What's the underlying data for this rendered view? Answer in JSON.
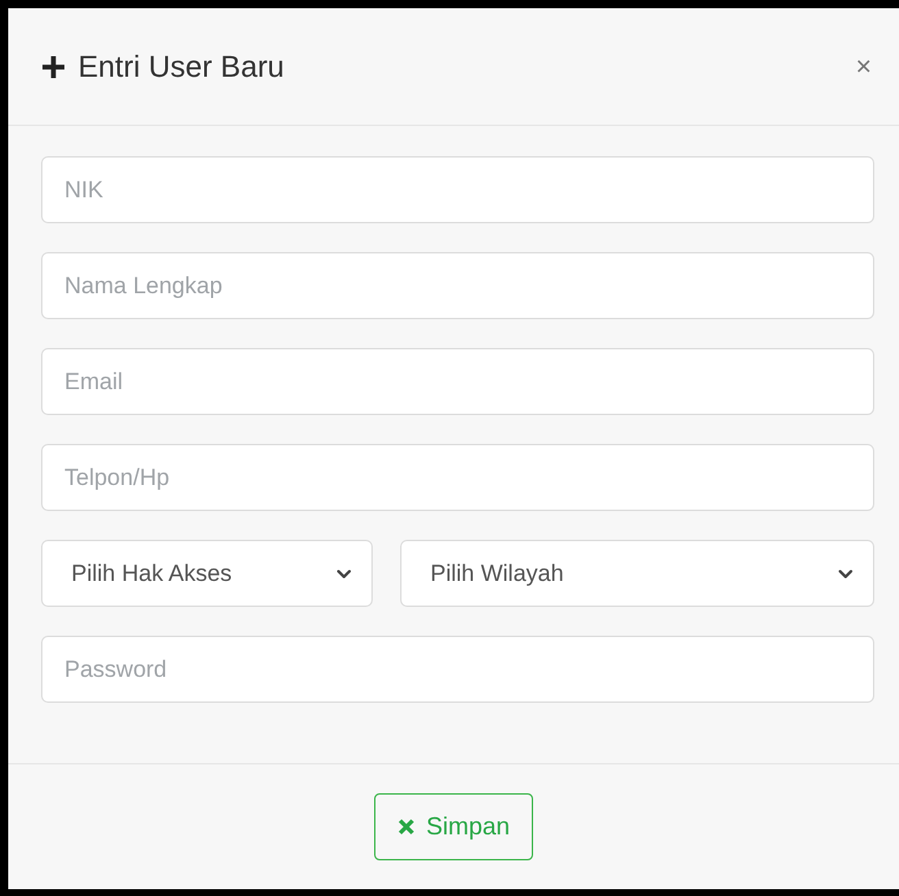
{
  "dialog": {
    "title": "Entri User Baru",
    "close": "×"
  },
  "rows": [
    {
      "kind": "input",
      "placeholder": "NIK"
    },
    {
      "kind": "input",
      "placeholder": "Nama Lengkap"
    },
    {
      "kind": "input",
      "placeholder": "Email"
    },
    {
      "kind": "input",
      "placeholder": "Telpon/Hp"
    },
    {
      "kind": "selects",
      "selects": [
        {
          "value": "Pilih Hak Akses"
        },
        {
          "value": "Pilih Wilayah"
        }
      ]
    },
    {
      "kind": "input",
      "placeholder": "Password"
    }
  ],
  "save_button": {
    "label": "Simpan"
  }
}
